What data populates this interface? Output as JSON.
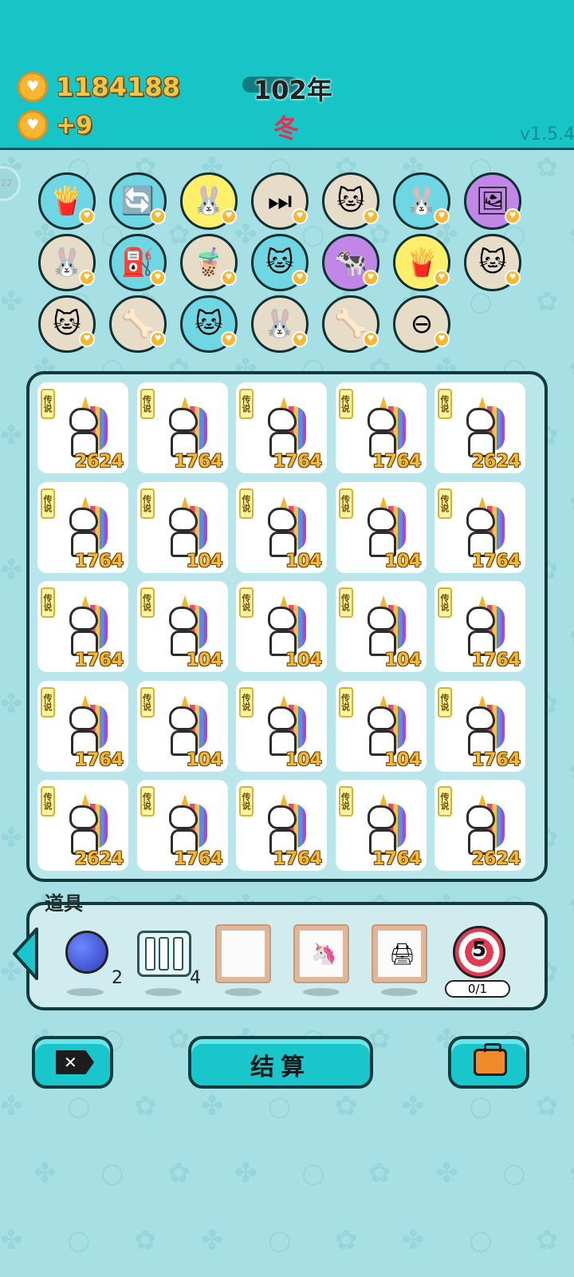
{
  "header": {
    "money": "1184188",
    "income": "+9",
    "year": "102年",
    "season": "冬",
    "version": "v1.5.4",
    "side_bubble": "22"
  },
  "upgrades": [
    {
      "icon": "🍟",
      "bg": "cyan",
      "name": "fries-icon"
    },
    {
      "icon": "🔄",
      "bg": "cyan",
      "name": "refresh-icon"
    },
    {
      "icon": "🐰",
      "bg": "yellow",
      "name": "rabbit-icon"
    },
    {
      "icon": "⏭",
      "bg": "beige",
      "name": "skip-icon"
    },
    {
      "icon": "🐱",
      "bg": "beige",
      "name": "cats-icon"
    },
    {
      "icon": "🐰",
      "bg": "cyan",
      "name": "rabbit-icon"
    },
    {
      "icon": "🖼",
      "bg": "purple",
      "name": "time-poster-icon"
    },
    {
      "icon": "🐰",
      "bg": "beige",
      "name": "rabbit-icon"
    },
    {
      "icon": "⛽",
      "bg": "cyan",
      "name": "pump-icon"
    },
    {
      "icon": "🧋",
      "bg": "beige",
      "name": "milk-tea-icon"
    },
    {
      "icon": "🐱",
      "bg": "cyan",
      "name": "husky-icon"
    },
    {
      "icon": "🐄",
      "bg": "purple",
      "name": "cows-icon"
    },
    {
      "icon": "🍟",
      "bg": "yellow",
      "name": "fries-icon"
    },
    {
      "icon": "🐱",
      "bg": "beige",
      "name": "cats-icon"
    },
    {
      "icon": "🐱",
      "bg": "beige",
      "name": "cats-icon"
    },
    {
      "icon": "🦴",
      "bg": "beige",
      "name": "dog-bowl-icon"
    },
    {
      "icon": "🐱",
      "bg": "cyan",
      "name": "cat-icon"
    },
    {
      "icon": "🐰",
      "bg": "beige",
      "name": "rabbit-icon"
    },
    {
      "icon": "🦴",
      "bg": "beige",
      "name": "dog-bowl-icon"
    },
    {
      "icon": "⊖",
      "bg": "beige",
      "name": "remove-icon"
    }
  ],
  "board": {
    "tag_label": "传说",
    "cells": [
      "2624",
      "1764",
      "1764",
      "1764",
      "2624",
      "1764",
      "104",
      "104",
      "104",
      "1764",
      "1764",
      "104",
      "104",
      "104",
      "1764",
      "1764",
      "104",
      "104",
      "104",
      "1764",
      "2624",
      "1764",
      "1764",
      "1764",
      "2624"
    ]
  },
  "items": {
    "title": "道具",
    "blueberry_count": "2",
    "bars_count": "4",
    "target_value": "5",
    "target_progress": "0/1"
  },
  "buttons": {
    "settle_label": "结算",
    "close_label": "✕"
  }
}
